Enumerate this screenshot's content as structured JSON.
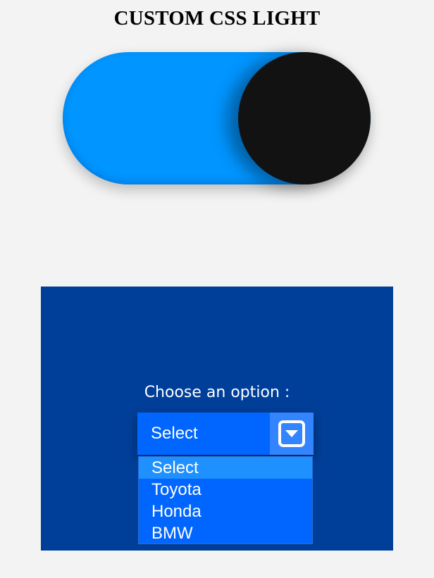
{
  "title": "CUSTOM CSS LIGHT",
  "toggle": {
    "state": "on",
    "track_color": "#0095ff",
    "knob_color": "#121212"
  },
  "panel": {
    "background": "#003f99",
    "label": "Choose an option :",
    "select": {
      "value": "Select",
      "icon": "chevron-down-icon",
      "options": [
        "Select",
        "Toyota",
        "Honda",
        "BMW"
      ],
      "highlighted_index": 0
    }
  }
}
